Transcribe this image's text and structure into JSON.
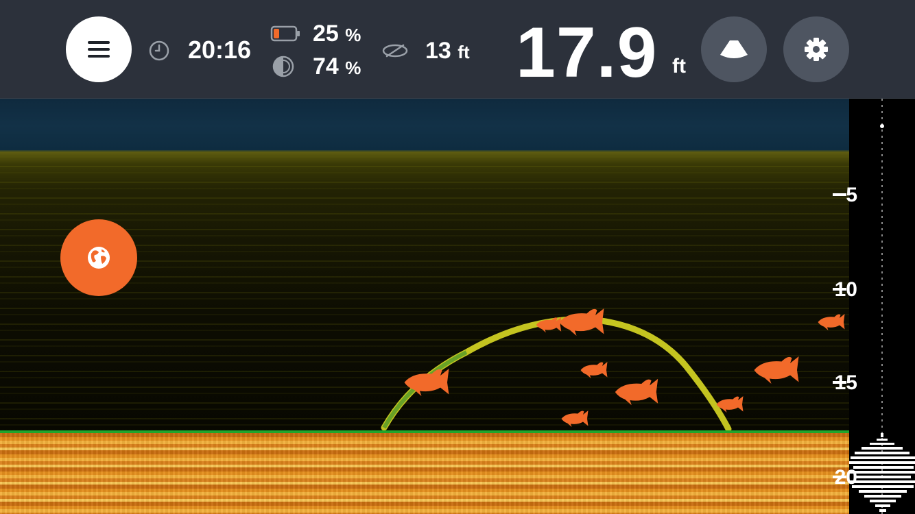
{
  "status": {
    "time": "20:16",
    "battery_percent": "25",
    "brightness_percent": "74",
    "percent_unit": "%",
    "temperature_value": "13",
    "temperature_unit": "ft"
  },
  "depth": {
    "value": "17.9",
    "unit": "ft"
  },
  "depth_scale": {
    "labels": [
      "5",
      "10",
      "15",
      "20"
    ]
  },
  "icons": {
    "menu": "hamburger-menu-icon",
    "clock": "clock-icon",
    "battery": "battery-icon",
    "brightness": "brightness-icon",
    "temperature": "temperature-icon",
    "sonar": "sonar-beam-icon",
    "settings": "gear-icon",
    "globe": "globe-icon",
    "fish": "fish-icon"
  },
  "colors": {
    "topbar": "#2c313b",
    "button_dark": "#4e5561",
    "accent_orange": "#f26a2a",
    "bottom_green": "#20a52c",
    "arch_yellow": "#e8e82a"
  }
}
